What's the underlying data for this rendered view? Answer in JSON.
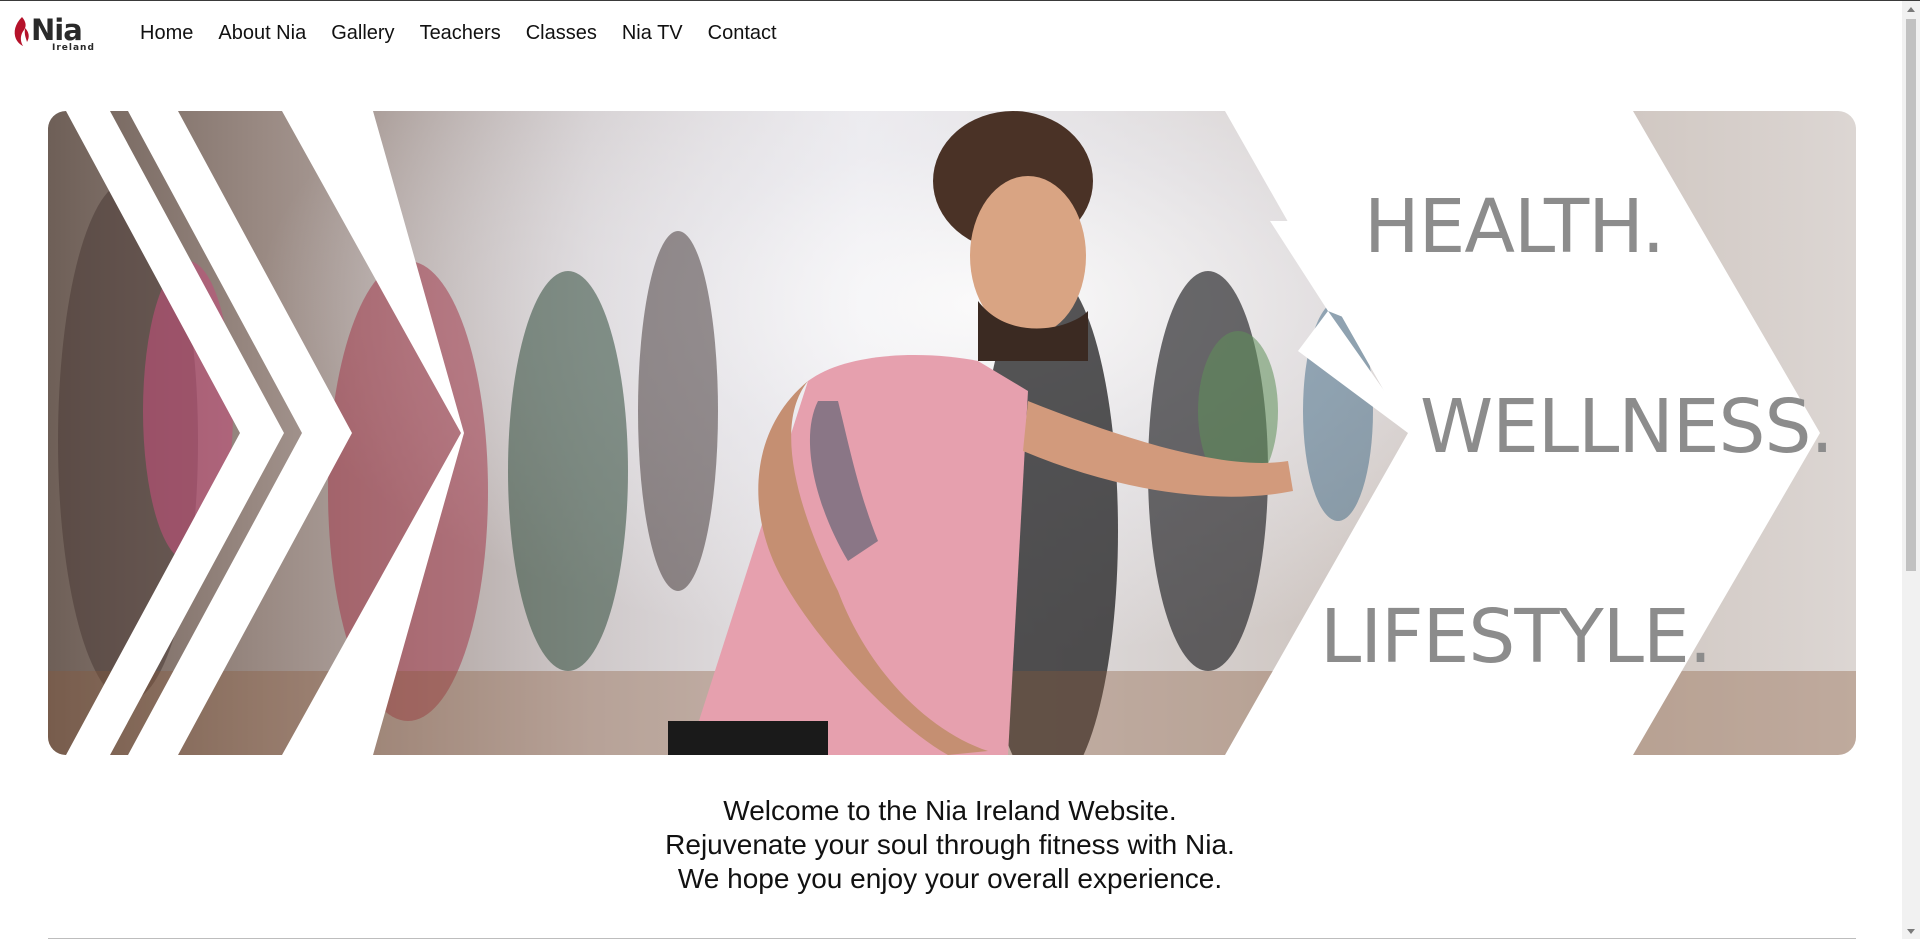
{
  "brand": {
    "name": "Nia",
    "sub": "Ireland",
    "logo_icon": "flame-leaf-icon",
    "logo_color": "#b5122a"
  },
  "nav": {
    "items": [
      {
        "label": "Home"
      },
      {
        "label": "About Nia"
      },
      {
        "label": "Gallery"
      },
      {
        "label": "Teachers"
      },
      {
        "label": "Classes"
      },
      {
        "label": "Nia TV"
      },
      {
        "label": "Contact"
      }
    ]
  },
  "hero": {
    "taglines": [
      "HEALTH.",
      "WELLNESS.",
      "LIFESTYLE."
    ],
    "tagline_color": "#8c8c8c",
    "image_alt_subject": "dance-class-photo"
  },
  "welcome": {
    "line1": "Welcome to the Nia Ireland Website.",
    "line2": "Rejuvenate your soul through fitness with Nia.",
    "line3": "We hope you enjoy your overall experience."
  }
}
